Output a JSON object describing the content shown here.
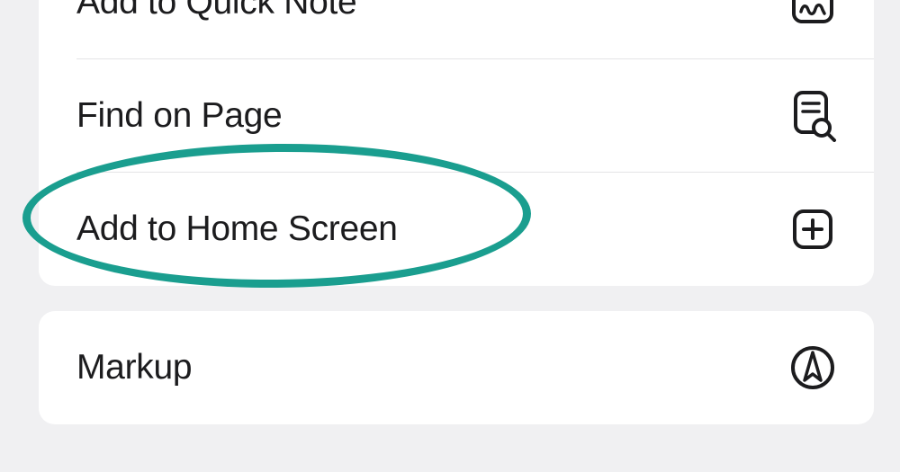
{
  "menu": {
    "group1": [
      {
        "label": "Add to Quick Note",
        "icon": "quick-note-icon"
      },
      {
        "label": "Find on Page",
        "icon": "find-on-page-icon"
      },
      {
        "label": "Add to Home Screen",
        "icon": "add-to-home-icon"
      }
    ],
    "group2": [
      {
        "label": "Markup",
        "icon": "markup-icon"
      }
    ]
  },
  "annotation": {
    "highlighted_item": "Add to Home Screen",
    "color": "#1a9e8f"
  }
}
